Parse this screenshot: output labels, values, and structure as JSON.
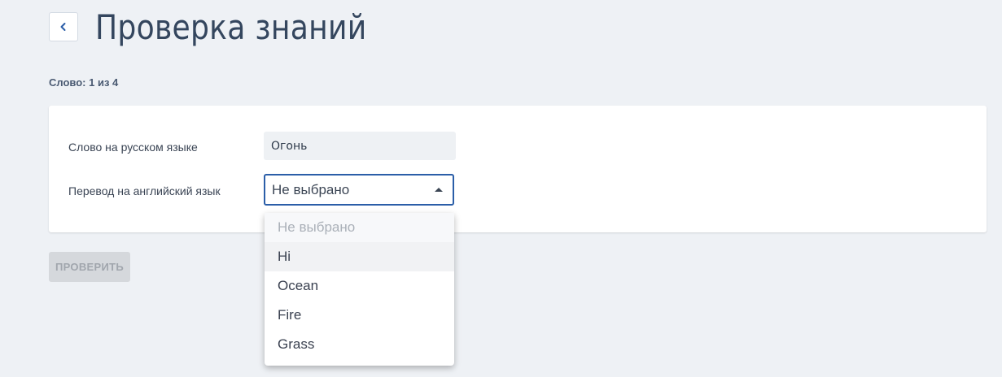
{
  "header": {
    "back_icon": "chevron-left-icon",
    "title": "Проверка знаний"
  },
  "progress": {
    "text": "Слово: 1 из 4"
  },
  "form": {
    "ru_label": "Слово на русском языке",
    "ru_word": "Огонь",
    "en_label": "Перевод на английский язык",
    "select_value": "Не выбрано",
    "select_caret_icon": "caret-up-icon"
  },
  "dropdown": {
    "options": [
      {
        "label": "Не выбрано",
        "state": "placeholder"
      },
      {
        "label": "Hi",
        "state": "hovered"
      },
      {
        "label": "Ocean",
        "state": "normal"
      },
      {
        "label": "Fire",
        "state": "normal"
      },
      {
        "label": "Grass",
        "state": "normal"
      }
    ]
  },
  "actions": {
    "check_label": "ПРОВЕРИТЬ",
    "check_disabled": true
  },
  "colors": {
    "background": "#eef1f5",
    "accent": "#2b5ea8",
    "title": "#34465e",
    "disabled_button": "#d5d8dc"
  }
}
